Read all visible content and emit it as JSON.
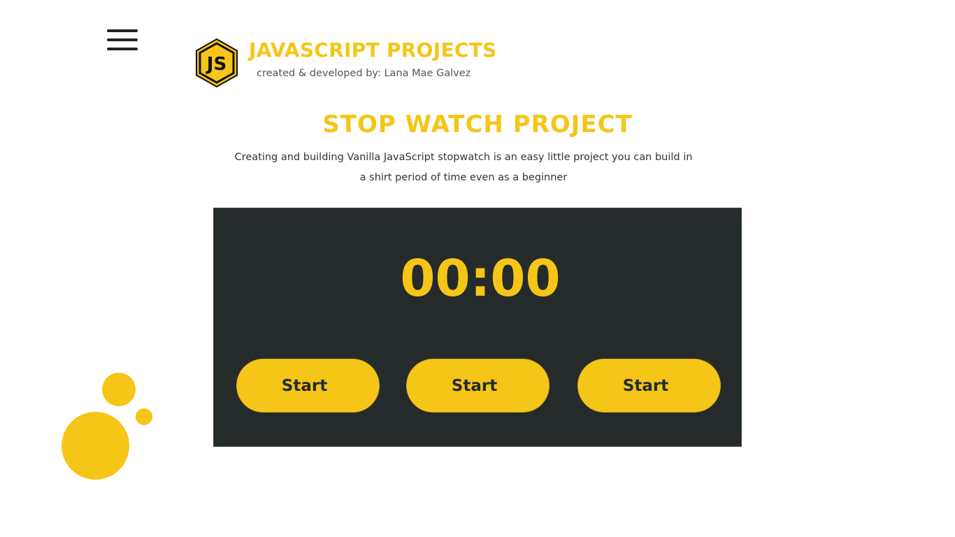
{
  "header": {
    "menu_icon": "hamburger-menu-icon",
    "logo_icon": "javascript-hexagon-logo",
    "logo_text": "JS",
    "title": "JAVASCRIPT PROJECTS",
    "subtitle": "created & developed by: Lana Mae Galvez"
  },
  "project": {
    "title": "STOP WATCH PROJECT",
    "description": "Creating and building Vanilla JavaScript stopwatch is an easy little project you can build in a shirt period of time even as a beginner"
  },
  "stopwatch": {
    "display": "00:00",
    "buttons": [
      {
        "label": "Start"
      },
      {
        "label": "Start"
      },
      {
        "label": "Start"
      }
    ]
  },
  "colors": {
    "accent": "#f5c518",
    "panel": "#252b2b",
    "text_dark": "#333333"
  }
}
